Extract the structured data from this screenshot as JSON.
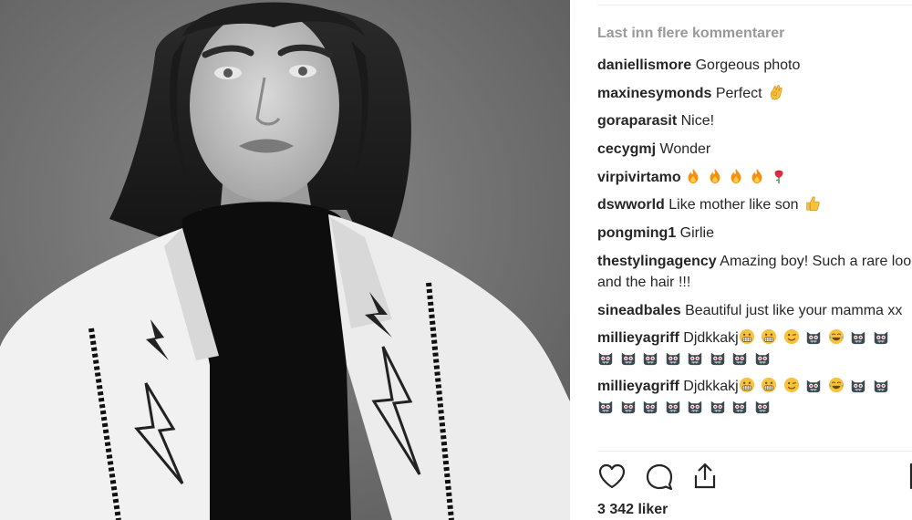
{
  "post": {
    "image_alt": "Black and white portrait photo"
  },
  "comments_panel": {
    "load_more_label": "Last inn flere kommentarer",
    "comments": [
      {
        "user": "daniellismore",
        "text": "Gorgeous photo",
        "emoji": []
      },
      {
        "user": "maxinesymonds",
        "text": "Perfect",
        "emoji": [
          "ok-hand"
        ]
      },
      {
        "user": "goraparasit",
        "text": "Nice!",
        "emoji": []
      },
      {
        "user": "cecygmj",
        "text": "Wonder",
        "emoji": []
      },
      {
        "user": "virpivirtamo",
        "text": "",
        "emoji": [
          "fire",
          "fire",
          "fire",
          "fire",
          "rose"
        ]
      },
      {
        "user": "dswworld",
        "text": "Like mother like son",
        "emoji": [
          "thumbs-up"
        ]
      },
      {
        "user": "pongming1",
        "text": "Girlie",
        "emoji": []
      },
      {
        "user": "thestylingagency",
        "text": "Amazing boy! Such a rare look and the hair !!!",
        "emoji": []
      },
      {
        "user": "sineadbales",
        "text": "Beautiful just like your mamma xx",
        "emoji": []
      },
      {
        "user": "millieyagriff",
        "text": "Djdkkakj",
        "emoji_line1": [
          "grimace",
          "grimace",
          "wink",
          "monster",
          "joy",
          "monster",
          "monster"
        ],
        "emoji_line2": [
          "monster",
          "monster",
          "monster",
          "monster",
          "monster",
          "monster",
          "monster",
          "monster"
        ]
      },
      {
        "user": "millieyagriff",
        "text": "Djdkkakj",
        "emoji_line1": [
          "grimace",
          "grimace",
          "wink",
          "monster",
          "joy",
          "monster",
          "monster"
        ],
        "emoji_line2": [
          "monster",
          "monster",
          "monster",
          "monster",
          "monster",
          "monster",
          "monster",
          "monster"
        ]
      }
    ]
  },
  "actions": {
    "like_icon": "heart-icon",
    "comment_icon": "comment-bubble-icon",
    "share_icon": "share-icon",
    "save_icon": "bookmark-icon"
  },
  "likes": {
    "label": "3 342 liker"
  },
  "colors": {
    "muted_text": "#999999",
    "text": "#262626",
    "divider": "#efefef",
    "emoji_yellow": "#f9c23c",
    "emoji_monster": "#3a4a50",
    "fire": "#f4900c",
    "rose": "#dd2e44"
  }
}
